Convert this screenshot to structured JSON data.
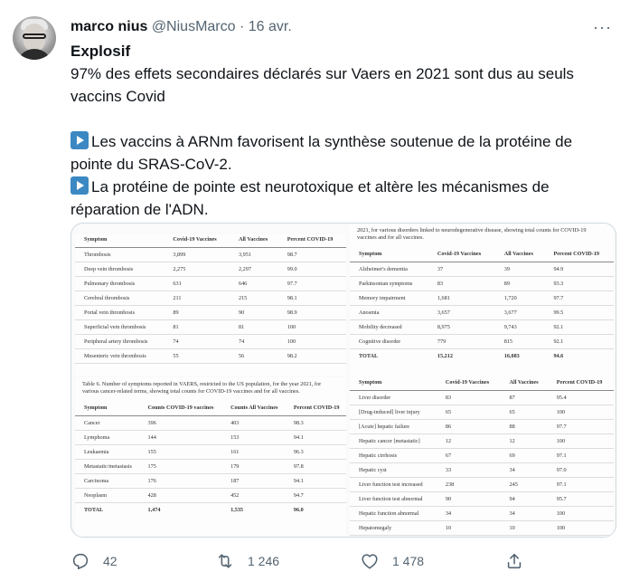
{
  "author": {
    "name": "marco nius",
    "handle": "@NiusMarco",
    "separator": "·",
    "date": "16 avr.",
    "more": "···"
  },
  "tweet": {
    "title": "Explosif",
    "line1": "97% des effets secondaires déclarés sur Vaers en 2021 sont dus au seuls vaccins Covid",
    "bullet1": "Les vaccins à ARNm favorisent la synthèse soutenue de la protéine de pointe du SRAS-CoV-2.",
    "bullet2": "La protéine de pointe est neurotoxique et altère les mécanismes de réparation de l'ADN."
  },
  "media": {
    "table1": {
      "headers": [
        "Symptom",
        "Covid-19 Vaccines",
        "All Vaccines",
        "Percent COVID-19"
      ],
      "rows": [
        [
          "Thrombosis",
          "3,899",
          "3,951",
          "98.7"
        ],
        [
          "Deep vein thrombosis",
          "2,275",
          "2,297",
          "99.0"
        ],
        [
          "Pulmonary thrombosis",
          "631",
          "646",
          "97.7"
        ],
        [
          "Cerebral thrombosis",
          "211",
          "215",
          "98.1"
        ],
        [
          "Portal vein thrombosis",
          "89",
          "90",
          "98.9"
        ],
        [
          "Superficial vein thrombosis",
          "81",
          "81",
          "100"
        ],
        [
          "Peripheral artery thrombosis",
          "74",
          "74",
          "100"
        ],
        [
          "Mesenteric vein thrombosis",
          "55",
          "56",
          "98.2"
        ]
      ]
    },
    "table2": {
      "caption": "Table 6. Number of symptoms reported in VAERS, restricted to the US population, for the year 2021, for various cancer-related terms, showing total counts for COVID-19 vaccines and for all vaccines.",
      "headers": [
        "Symptom",
        "Counts COVID-19 vaccines",
        "Counts All Vaccines",
        "Percent COVID-19"
      ],
      "rows": [
        [
          "Cancer",
          "396",
          "403",
          "98.3"
        ],
        [
          "Lymphoma",
          "144",
          "153",
          "94.1"
        ],
        [
          "Leukaemia",
          "155",
          "161",
          "96.3"
        ],
        [
          "Metastatic/metastasis",
          "175",
          "179",
          "97.8"
        ],
        [
          "Carcinoma",
          "176",
          "187",
          "94.1"
        ],
        [
          "Neoplasm",
          "428",
          "452",
          "94.7"
        ]
      ],
      "total": [
        "TOTAL",
        "1,474",
        "1,535",
        "96.0"
      ]
    },
    "table3": {
      "caption": "2021, for various disorders linked to neurodegenerative disease, showing total counts for COVID-19 vaccines and for all vaccines.",
      "headers": [
        "Symptom",
        "Covid-19 Vaccines",
        "All Vaccines",
        "Percent COVID-19"
      ],
      "rows": [
        [
          "Alzheimer's dementia",
          "37",
          "39",
          "94.9"
        ],
        [
          "Parkinsonian symptoms",
          "83",
          "89",
          "93.3"
        ],
        [
          "Memory impairment",
          "1,681",
          "1,720",
          "97.7"
        ],
        [
          "Anosmia",
          "3,657",
          "3,677",
          "99.5"
        ],
        [
          "Mobility decreased",
          "8,975",
          "9,743",
          "92.1"
        ],
        [
          "Cognitive disorder",
          "779",
          "815",
          "92.1"
        ]
      ],
      "total": [
        "TOTAL",
        "15,212",
        "16,083",
        "94.6"
      ]
    },
    "table4": {
      "headers": [
        "Symptom",
        "Covid-19 Vaccines",
        "All Vaccines",
        "Percent COVID-19"
      ],
      "rows": [
        [
          "Liver disorder",
          "83",
          "87",
          "95.4"
        ],
        [
          "[Drug-induced] liver injury",
          "65",
          "65",
          "100"
        ],
        [
          "[Acute] hepatic failure",
          "86",
          "88",
          "97.7"
        ],
        [
          "Hepatic cancer [metastatic]",
          "12",
          "12",
          "100"
        ],
        [
          "Hepatic cirrhosis",
          "67",
          "69",
          "97.1"
        ],
        [
          "Hepatic cyst",
          "33",
          "34",
          "97.0"
        ],
        [
          "Liver function test increased",
          "238",
          "245",
          "97.1"
        ],
        [
          "Liver function test abnormal",
          "90",
          "94",
          "95.7"
        ],
        [
          "Hepatic function abnormal",
          "34",
          "34",
          "100"
        ],
        [
          "Hepatomegaly",
          "10",
          "10",
          "100"
        ]
      ]
    }
  },
  "actions": {
    "replies": "42",
    "retweets": "1 246",
    "likes": "1 478"
  },
  "colors": {
    "text": "#0f1419",
    "secondary": "#536471",
    "border": "#cfd9de",
    "emoji_blue": "#3b88c3"
  }
}
